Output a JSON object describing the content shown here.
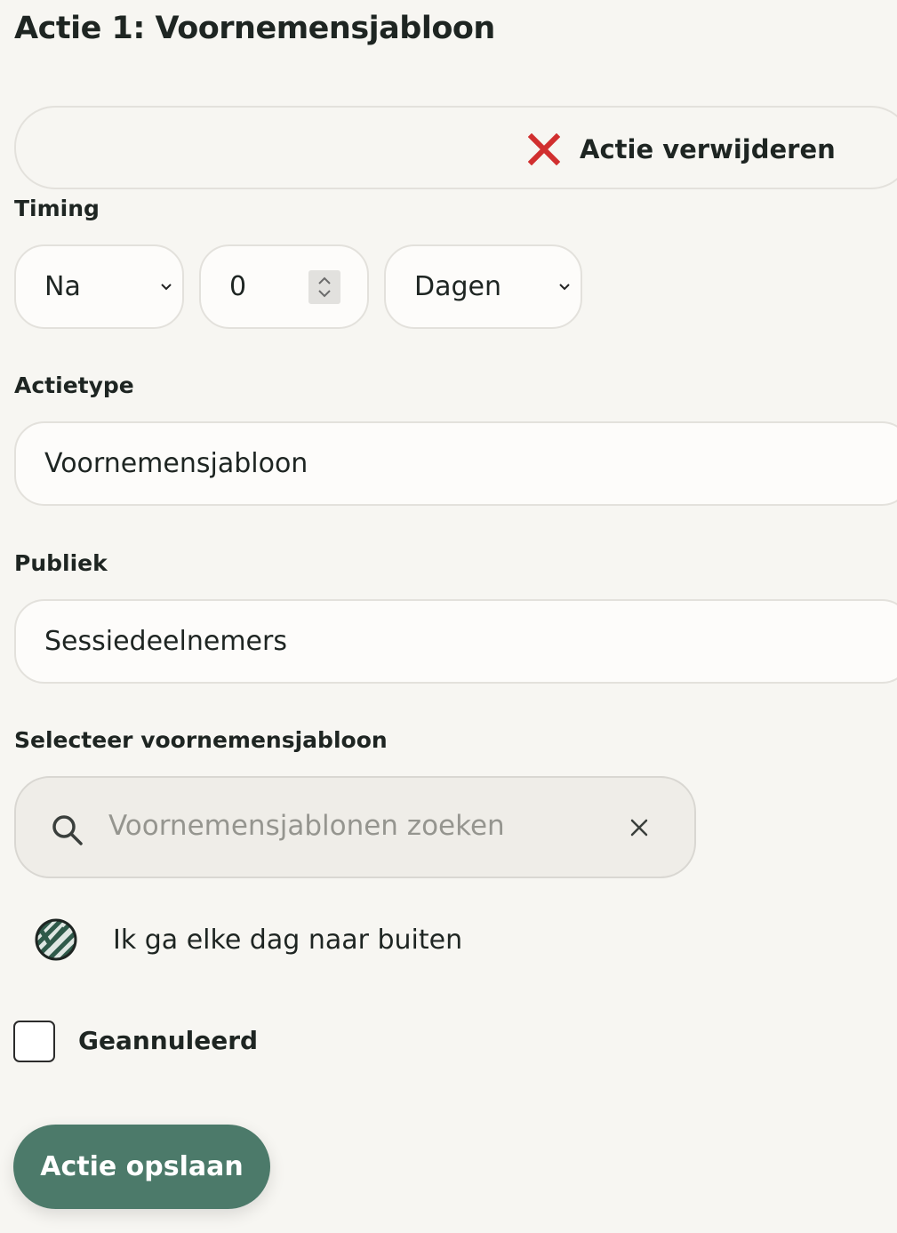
{
  "page_title": "Actie 1: Voornemensjabloon",
  "remove_action_label": "Actie verwijderen",
  "timing": {
    "label": "Timing",
    "relation": "Na",
    "amount": "0",
    "unit": "Dagen"
  },
  "action_type": {
    "label": "Actietype",
    "value": "Voornemensjabloon"
  },
  "audience": {
    "label": "Publiek",
    "value": "Sessiedeelnemers"
  },
  "template_select": {
    "label": "Selecteer voornemensjabloon",
    "search_placeholder": "Voornemensjablonen zoeken",
    "items": [
      "Ik ga elke dag naar buiten"
    ]
  },
  "cancelled_label": "Geannuleerd",
  "cancelled_checked": false,
  "save_label": "Actie opslaan",
  "colors": {
    "accent": "#4c7a6a",
    "danger": "#d12f2f",
    "background": "#f7f6f2"
  },
  "icons": {
    "remove": "close-x-icon",
    "search": "search-icon",
    "clear": "clear-icon",
    "template": "striped-circle-icon"
  }
}
